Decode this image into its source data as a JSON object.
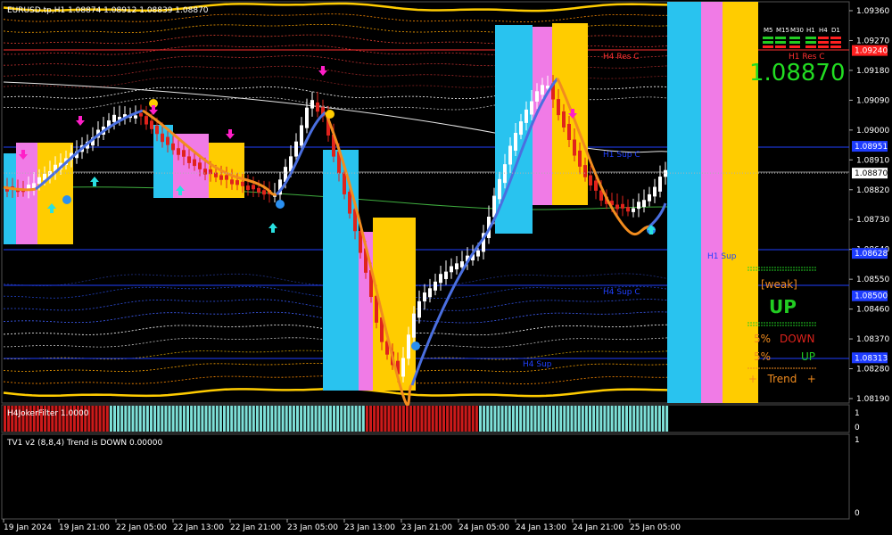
{
  "main_chart": {
    "title": "EURUSD.tp,H1  1.08874 1.08912 1.08839 1.08870",
    "price_ticks": [
      "1.09360",
      "1.09270",
      "1.09180",
      "1.09090",
      "1.09000",
      "1.08910",
      "1.08820",
      "1.08730",
      "1.08640",
      "1.08550",
      "1.08460",
      "1.08370",
      "1.08280",
      "1.08190"
    ],
    "price_tags": [
      {
        "value": "1.09240",
        "color": "#ff2020"
      },
      {
        "value": "1.08951",
        "color": "#1e3cff"
      },
      {
        "value": "1.08870",
        "color": "#ffffff"
      },
      {
        "value": "1.08628",
        "color": "#1e3cff"
      },
      {
        "value": "1.08500",
        "color": "#1e3cff"
      },
      {
        "value": "1.08313",
        "color": "#1e3cff"
      }
    ],
    "level_labels": [
      {
        "text": "H4 Res C",
        "color": "#ff3030"
      },
      {
        "text": "H1 Res C",
        "color": "#ff3030"
      },
      {
        "text": "H1 Sup C",
        "color": "#2040ff"
      },
      {
        "text": "H1 Sup",
        "color": "#2040ff"
      },
      {
        "text": "H4 Sup C",
        "color": "#2040ff"
      },
      {
        "text": "H4 Sup",
        "color": "#2040ff"
      }
    ]
  },
  "timeframe_panel": {
    "labels": [
      "M5",
      "M15",
      "M30",
      "H1",
      "H4",
      "D1"
    ],
    "rows": [
      [
        "#22cc22",
        "#22cc22",
        "#22cc22",
        "#22cc22",
        "#ff2020",
        "#ff2020"
      ],
      [
        "#22cc22",
        "#22cc22",
        "#22cc22",
        "#22cc22",
        "#ff2020",
        "#ff2020"
      ],
      [
        "#ff2020",
        "#ff2020",
        "#ff2020",
        "#ff2020",
        "#ff2020",
        "#ff2020"
      ]
    ],
    "current_price": "1.08870"
  },
  "signal_panel": {
    "strength": "[weak]",
    "direction": "UP",
    "down_pct": "5%",
    "down_label": "DOWN",
    "up_pct": "5%",
    "up_label": "UP",
    "trend_label": "+   Trend   +"
  },
  "sub1": {
    "label": "H4JokerFilter 1.0000",
    "ticks": [
      "1",
      "0"
    ]
  },
  "sub2": {
    "label": "TV1 v2 (8,8,4) Trend is DOWN 0.00000",
    "ticks": [
      "1",
      "0"
    ]
  },
  "time_axis": [
    "19 Jan 2024",
    "19 Jan 21:00",
    "22 Jan 05:00",
    "22 Jan 13:00",
    "22 Jan 21:00",
    "23 Jan 05:00",
    "23 Jan 13:00",
    "23 Jan 21:00",
    "24 Jan 05:00",
    "24 Jan 13:00",
    "24 Jan 21:00",
    "25 Jan 05:00"
  ],
  "colors": {
    "bull": "#ffffff",
    "bear": "#e0231c",
    "hma_up": "#4a6fe0",
    "hma_down": "#f28c1e",
    "zone_cyan": "#29c3ef",
    "zone_pink": "#f07be6",
    "zone_yellow": "#ffcc00"
  }
}
